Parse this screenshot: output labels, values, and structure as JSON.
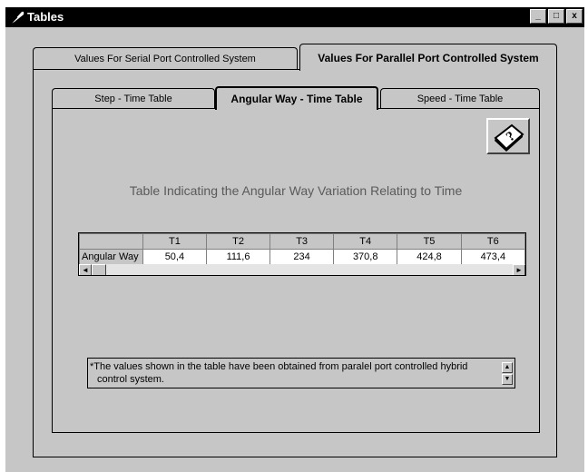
{
  "window": {
    "title": "Tables",
    "controls": {
      "minimize": "_",
      "maximize": "□",
      "close": "x"
    }
  },
  "outer_tabs": [
    {
      "label": "Values For Serial Port Controlled System",
      "active": false
    },
    {
      "label": "Values For Parallel Port Controlled System",
      "active": true
    }
  ],
  "inner_tabs": [
    {
      "label": "Step - Time Table",
      "active": false
    },
    {
      "label": "Angular Way - Time Table",
      "active": true
    },
    {
      "label": "Speed - Time Table",
      "active": false
    }
  ],
  "help_button": {
    "icon": "book-help-icon",
    "glyph": "?"
  },
  "table_caption": "Table Indicating the Angular Way Variation Relating to Time",
  "grid": {
    "columns": [
      "",
      "T1",
      "T2",
      "T3",
      "T4",
      "T5",
      "T6"
    ],
    "row_label": "Angular Way",
    "values": [
      "50,4",
      "111,6",
      "234",
      "370,8",
      "424,8",
      "473,4"
    ]
  },
  "scrollbar": {
    "left_arrow": "◄",
    "right_arrow": "►",
    "up_arrow": "▲",
    "down_arrow": "▼"
  },
  "note": {
    "line1": "*The values shown in the table have been obtained from paralel port controlled hybrid",
    "line2": "control system."
  },
  "colors": {
    "face": "#c6c6c6",
    "titlebar": "#000000",
    "caption": "#5a5a5a"
  }
}
